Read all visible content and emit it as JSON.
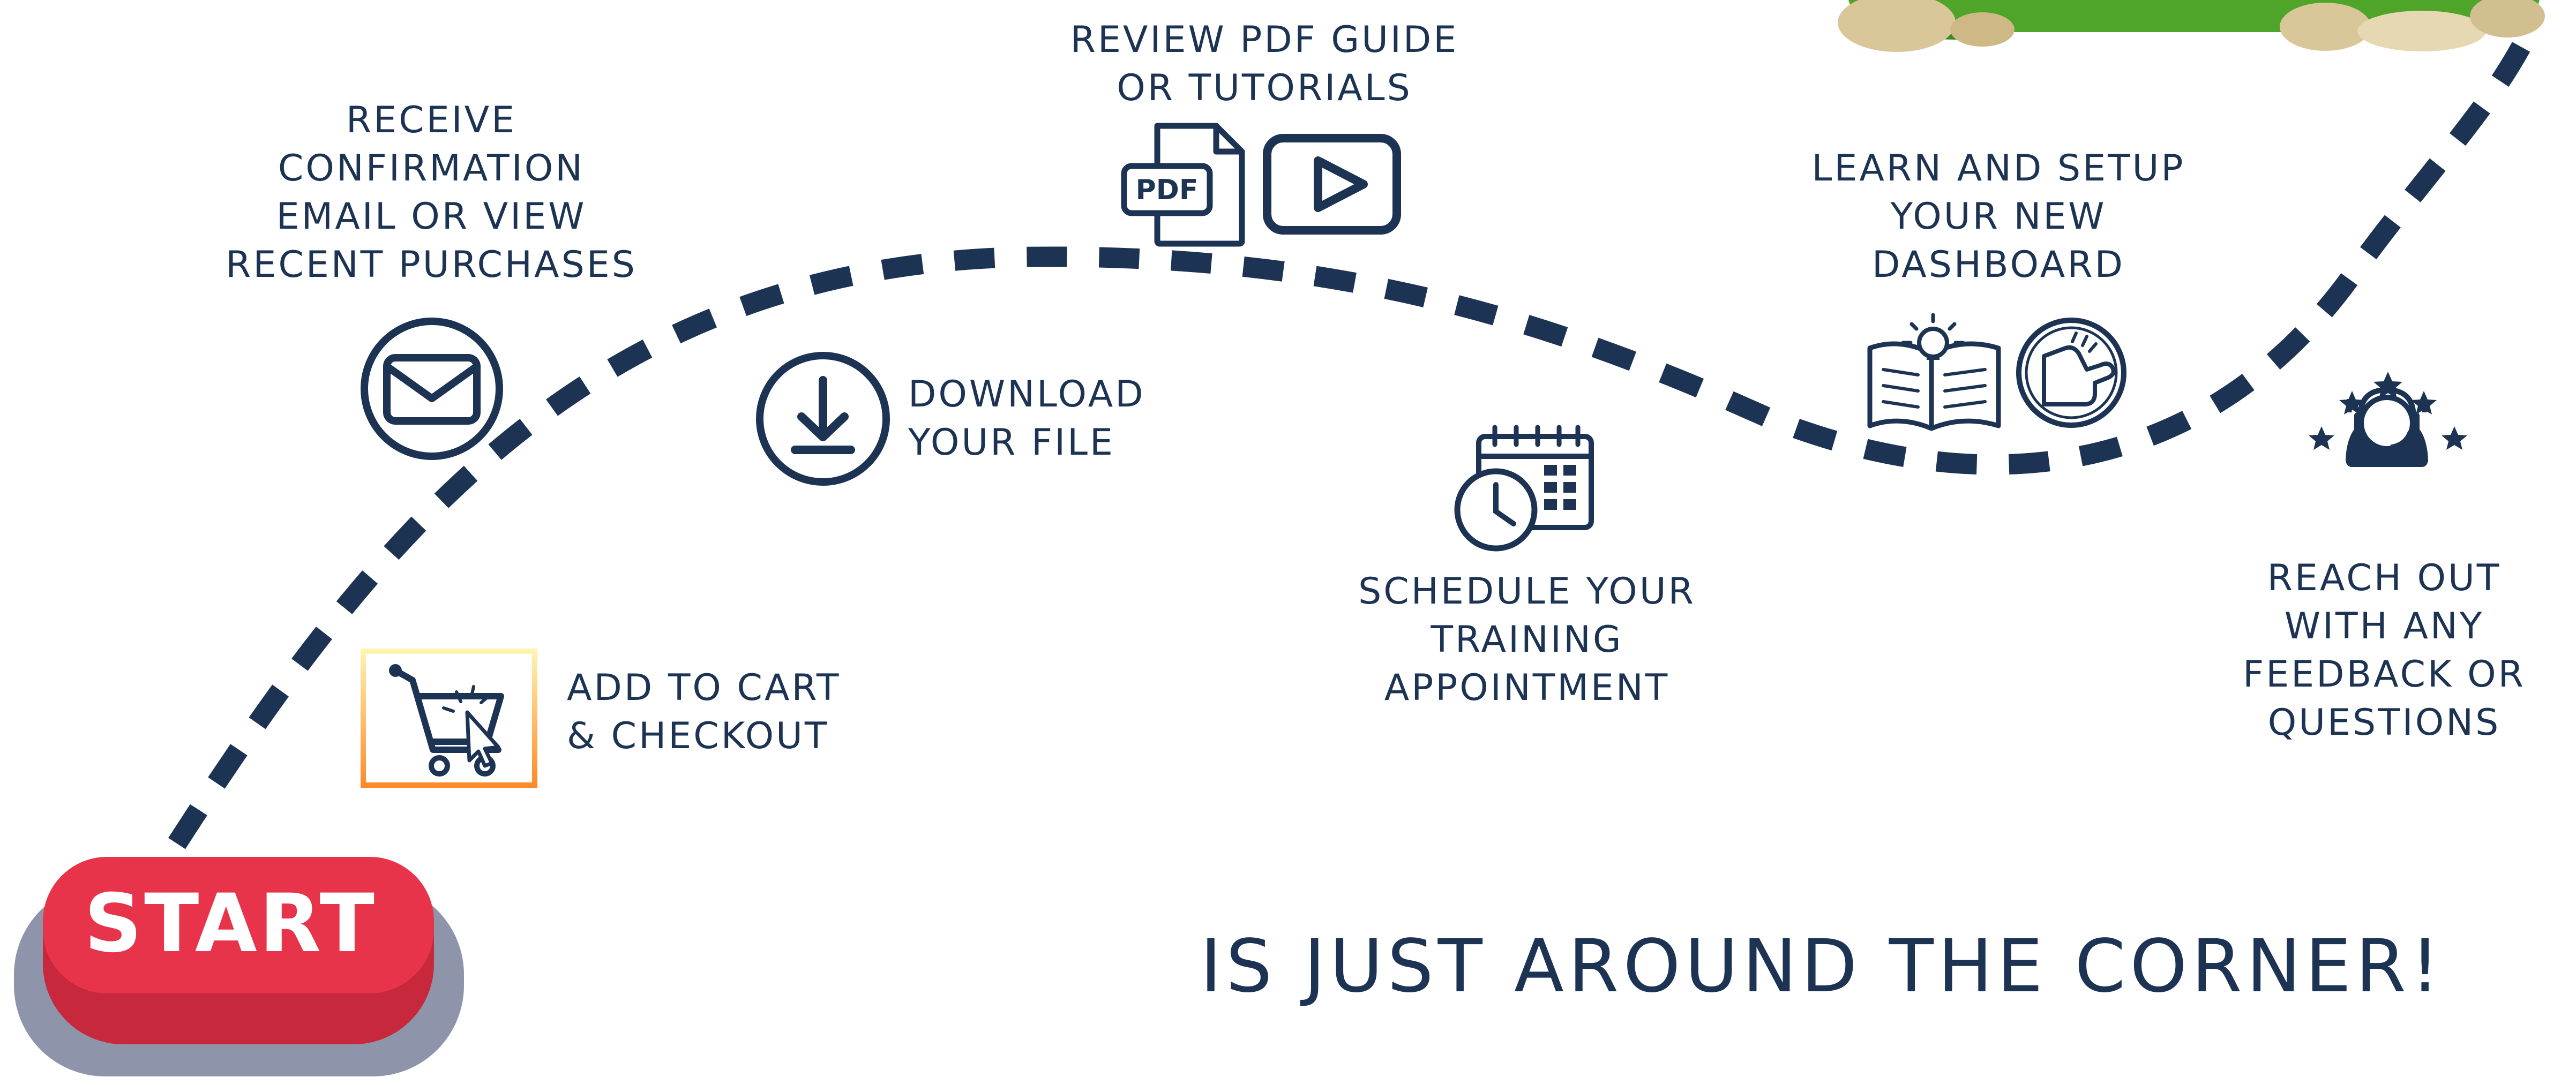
{
  "colors": {
    "navy": "#1c3354",
    "start_red": "#e8344a",
    "start_shadow": "#8e94aa",
    "cart_gradient_top": "#fff3b0",
    "cart_gradient_bottom": "#ff8a2a",
    "grass": "#4fa52a",
    "stone": "#d9c79a"
  },
  "start_button": {
    "label": "START"
  },
  "steps": {
    "add_to_cart": {
      "lines": [
        "ADD TO CART",
        "& CHECKOUT"
      ],
      "icon": "cart-cursor-icon"
    },
    "receive": {
      "lines": [
        "RECEIVE",
        "CONFIRMATION",
        "EMAIL OR VIEW",
        "RECENT PURCHASES"
      ],
      "icon": "envelope-icon"
    },
    "download": {
      "lines": [
        "DOWNLOAD",
        "YOUR FILE"
      ],
      "icon": "download-icon"
    },
    "review": {
      "lines": [
        "REVIEW PDF GUIDE",
        "OR TUTORIALS"
      ],
      "icons": [
        "pdf-file-icon",
        "play-button-icon"
      ],
      "pdf_badge": "PDF"
    },
    "schedule": {
      "lines": [
        "SCHEDULE YOUR",
        "TRAINING",
        "APPOINTMENT"
      ],
      "icon": "calendar-clock-icon"
    },
    "learn": {
      "lines": [
        "LEARN AND SETUP",
        "YOUR NEW",
        "DASHBOARD"
      ],
      "icons": [
        "book-lightbulb-icon",
        "pointing-hand-icon"
      ]
    },
    "reach_out": {
      "lines": [
        "REACH OUT",
        "WITH ANY",
        "FEEDBACK OR",
        "QUESTIONS"
      ],
      "icon": "support-agent-stars-icon"
    }
  },
  "tagline": "IS JUST AROUND THE CORNER!"
}
